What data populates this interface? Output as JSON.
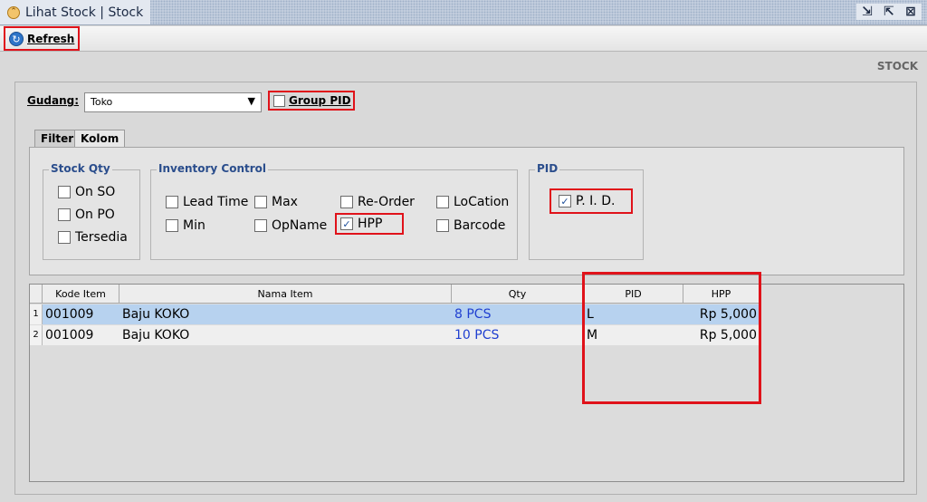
{
  "window": {
    "title": "Lihat Stock | Stock"
  },
  "toolbar": {
    "refresh_label": "Refresh"
  },
  "section": {
    "label": "STOCK"
  },
  "gudang": {
    "label": "Gudang:",
    "value": "Toko"
  },
  "group_pid": {
    "label": "Group PID",
    "checked": false
  },
  "tabs": [
    {
      "label": "Filter"
    },
    {
      "label": "Kolom"
    }
  ],
  "groups": {
    "stock_qty": {
      "title": "Stock Qty",
      "items": [
        {
          "label": "On SO",
          "checked": false
        },
        {
          "label": "On PO",
          "checked": false
        },
        {
          "label": "Tersedia",
          "checked": false
        }
      ]
    },
    "inventory_control": {
      "title": "Inventory Control",
      "items": [
        {
          "label": "Lead Time",
          "checked": false
        },
        {
          "label": "Max",
          "checked": false
        },
        {
          "label": "Re-Order",
          "checked": false
        },
        {
          "label": "LoCation",
          "checked": false
        },
        {
          "label": "Min",
          "checked": false
        },
        {
          "label": "OpName",
          "checked": false
        },
        {
          "label": "HPP",
          "checked": true
        },
        {
          "label": "Barcode",
          "checked": false
        }
      ]
    },
    "pid": {
      "title": "PID",
      "items": [
        {
          "label": "P. I. D.",
          "checked": true
        }
      ]
    }
  },
  "grid": {
    "columns": [
      "Kode Item",
      "Nama Item",
      "Qty",
      "PID",
      "HPP"
    ],
    "rows": [
      {
        "num": "1",
        "kode": "001009",
        "nama": "Baju KOKO",
        "qty": "8 PCS",
        "pid": "L",
        "hpp": "Rp 5,000"
      },
      {
        "num": "2",
        "kode": "001009",
        "nama": "Baju KOKO",
        "qty": "10 PCS",
        "pid": "M",
        "hpp": "Rp 5,000"
      }
    ]
  },
  "colors": {
    "highlight": "#e0121a",
    "selected_row": "#b7d2ef",
    "qty_text": "#1f3fd0",
    "group_title": "#2a4d8c"
  }
}
